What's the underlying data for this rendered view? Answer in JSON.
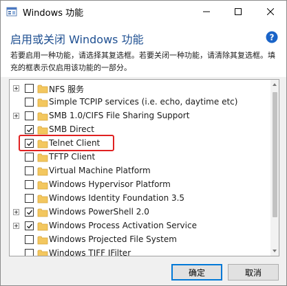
{
  "titlebar": {
    "title": "Windows 功能",
    "icon": "windows-features-icon",
    "minimize_icon": "minimize-icon",
    "maximize_icon": "maximize-icon",
    "close_icon": "close-icon"
  },
  "header": {
    "heading": "启用或关闭 Windows 功能",
    "description": "若要启用一种功能，请选择其复选框。若要关闭一种功能，请清除其复选框。填充的框表示仅启用该功能的一部分。",
    "help_icon": "help-icon"
  },
  "features": [
    {
      "label": "NFS 服务",
      "expandable": true,
      "state": "unchecked"
    },
    {
      "label": "Simple TCPIP services (i.e. echo, daytime etc)",
      "expandable": false,
      "state": "unchecked"
    },
    {
      "label": "SMB 1.0/CIFS File Sharing Support",
      "expandable": true,
      "state": "unchecked"
    },
    {
      "label": "SMB Direct",
      "expandable": false,
      "state": "checked"
    },
    {
      "label": "Telnet Client",
      "expandable": false,
      "state": "checked",
      "highlighted": true
    },
    {
      "label": "TFTP Client",
      "expandable": false,
      "state": "unchecked"
    },
    {
      "label": "Virtual Machine Platform",
      "expandable": false,
      "state": "unchecked"
    },
    {
      "label": "Windows Hypervisor Platform",
      "expandable": false,
      "state": "unchecked"
    },
    {
      "label": "Windows Identity Foundation 3.5",
      "expandable": false,
      "state": "unchecked"
    },
    {
      "label": "Windows PowerShell 2.0",
      "expandable": true,
      "state": "checked"
    },
    {
      "label": "Windows Process Activation Service",
      "expandable": true,
      "state": "checked"
    },
    {
      "label": "Windows Projected File System",
      "expandable": false,
      "state": "unchecked"
    },
    {
      "label": "Windows TIFF IFilter",
      "expandable": false,
      "state": "unchecked"
    }
  ],
  "buttons": {
    "ok": "确定",
    "cancel": "取消"
  },
  "colors": {
    "heading": "#1e4f91",
    "highlight": "#e02020",
    "default_button_border": "#0078d7",
    "folder": "#f3c75f"
  }
}
